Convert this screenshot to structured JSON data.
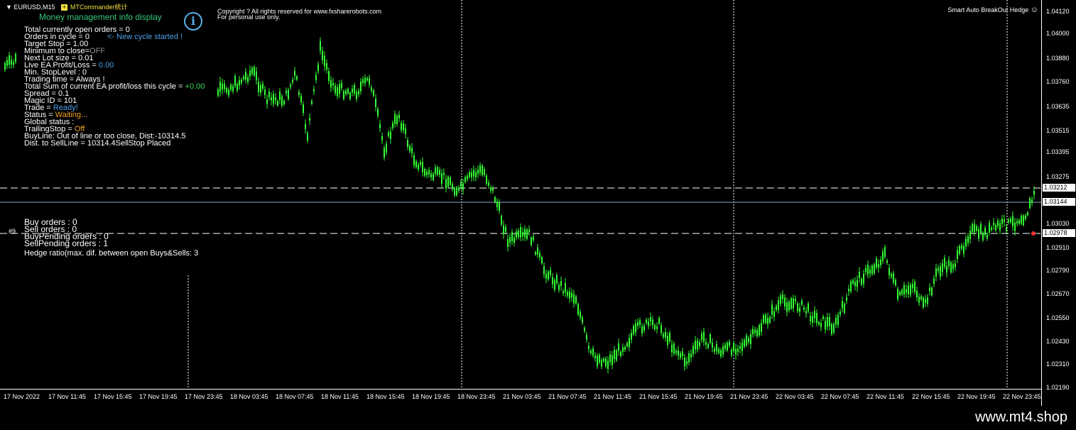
{
  "colors": {
    "background": "#000000",
    "candle": "#33ff33",
    "label_white": "#ffffff",
    "title_green": "#35c97a",
    "value_blue": "#4f9fe8",
    "value_green": "#33dd55",
    "value_orange": "#f0a020",
    "value_gray": "#8a8a8a"
  },
  "chart": {
    "symbol": "EURUSD,M15",
    "indicator_name": "MTCommander统计",
    "copyright": "Copyright ? All rights reserved for www.fxsharerobots.com",
    "personal_use": "For personal use only.",
    "ea_name": "Smart Auto BreakOut Hedge",
    "ea_face": "☺",
    "order_ticket": "#9",
    "watermark": "www.mt4.shop"
  },
  "panel": {
    "title": "Money management info display",
    "info_icon": "info-icon",
    "lines": [
      {
        "label": "Total currently open orders = 0",
        "value": ""
      },
      {
        "label": "Orders in cycle = 0",
        "value": ""
      },
      {
        "label": "Target Stop = 1.00",
        "value": ""
      },
      {
        "label": "Minimum to close=",
        "value": "OFF"
      },
      {
        "label": "Next Lot size = 0.01",
        "value": ""
      },
      {
        "label": "Live EA Profit/Loss = ",
        "value": "0.00"
      },
      {
        "label": "Min. StopLevel : 0",
        "value": ""
      },
      {
        "label": "Trading time = Always !",
        "value": ""
      },
      {
        "label": "Total Sum of current EA profit/loss this cycle = ",
        "value": "+0.00"
      },
      {
        "label": "Spread = 0.1",
        "value": ""
      },
      {
        "label": "Magic ID = 101",
        "value": ""
      },
      {
        "label": "Trade = ",
        "value": "Ready!"
      },
      {
        "label": "Status = ",
        "value": "Waiting..."
      },
      {
        "label": "Global status :",
        "value": ""
      },
      {
        "label": "TrailingStop = ",
        "value": "Off"
      },
      {
        "label": "BuyLine: Out of line or too close, Dist:-10314.5",
        "value": ""
      },
      {
        "label": "Dist. to SellLine = 10314.4",
        "value": "SellStop Placed"
      }
    ],
    "cycle_note": "<- New cycle started !",
    "orders": {
      "buy": "Buy orders : 0",
      "sell": "Sell orders : 0",
      "buy_pending": "BuyPending orders : 0",
      "sell_pending": "SellPending orders : 1",
      "hedge": "Hedge ratio(max. dif. between open Buys&Sells: 3"
    }
  },
  "price_axis": {
    "labels": [
      "1.04120",
      "1.04000",
      "1.03880",
      "1.03760",
      "1.03635",
      "1.03515",
      "1.03395",
      "1.03275",
      "1.03030",
      "1.02910",
      "1.02790",
      "1.02670",
      "1.02550",
      "1.02430",
      "1.02310",
      "1.02190"
    ],
    "boxes": [
      "1.03212",
      "1.03144",
      "1.02978"
    ]
  },
  "time_axis": {
    "labels": [
      "17 Nov 2022",
      "17 Nov 11:45",
      "17 Nov 15:45",
      "17 Nov 19:45",
      "17 Nov 23:45",
      "18 Nov 03:45",
      "18 Nov 07:45",
      "18 Nov 11:45",
      "18 Nov 15:45",
      "18 Nov 19:45",
      "18 Nov 23:45",
      "21 Nov 03:45",
      "21 Nov 07:45",
      "21 Nov 11:45",
      "21 Nov 15:45",
      "21 Nov 19:45",
      "21 Nov 23:45",
      "22 Nov 03:45",
      "22 Nov 07:45",
      "22 Nov 11:45",
      "22 Nov 15:45",
      "22 Nov 19:45",
      "22 Nov 23:45"
    ]
  },
  "price_scale": {
    "top": 1.0412,
    "bottom": 1.0219
  }
}
